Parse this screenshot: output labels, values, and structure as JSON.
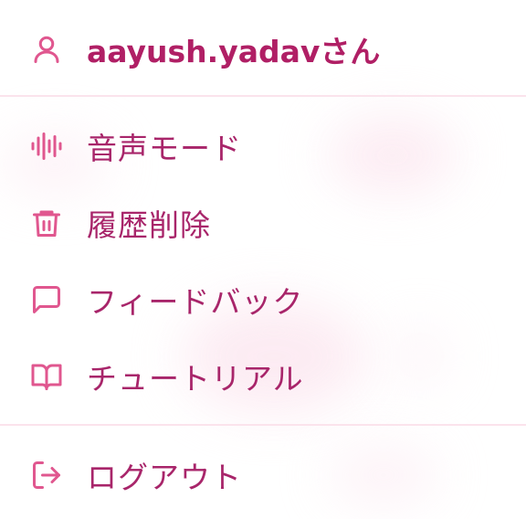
{
  "user": {
    "name": "aayush.yadavさん",
    "icon": "user-icon"
  },
  "menu": {
    "items": [
      {
        "label": "音声モード",
        "icon": "audio-waveform-icon"
      },
      {
        "label": "履歴削除",
        "icon": "trash-icon"
      },
      {
        "label": "フィードバック",
        "icon": "message-square-icon"
      },
      {
        "label": "チュートリアル",
        "icon": "book-open-icon"
      }
    ],
    "logout": {
      "label": "ログアウト",
      "icon": "logout-icon"
    }
  },
  "colors": {
    "accent": "#e0578f",
    "text": "#a8256a",
    "divider": "#fbe3ec"
  }
}
